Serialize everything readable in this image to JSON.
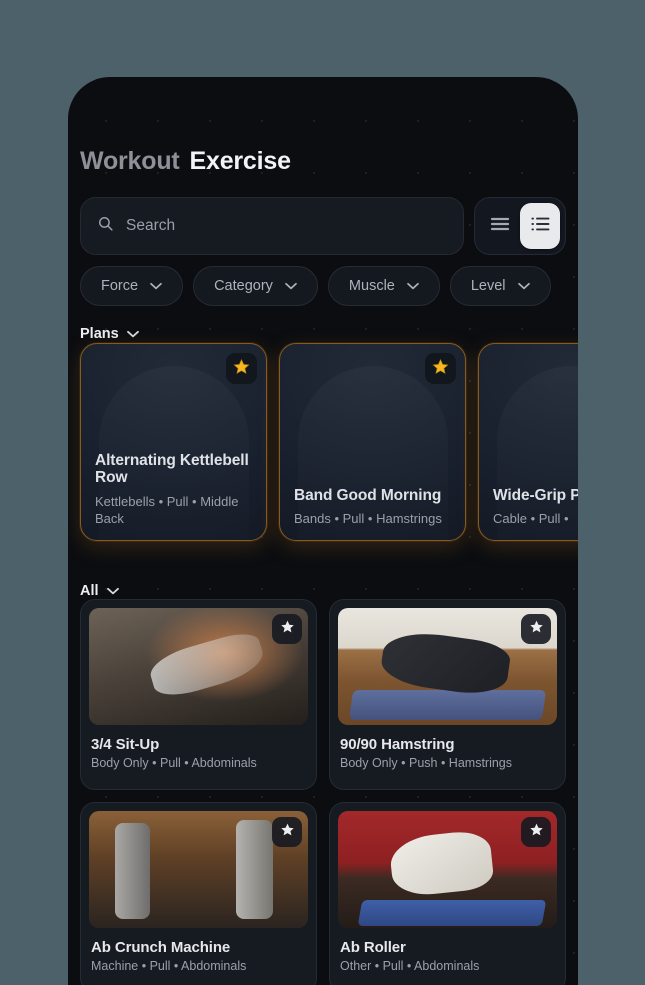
{
  "app": {
    "title_muted": "Workout",
    "title_strong": "Exercise"
  },
  "search": {
    "placeholder": "Search",
    "value": "",
    "icon": "search-icon"
  },
  "view_toggle": {
    "options": [
      {
        "name": "list-view",
        "icon": "hamburger-icon",
        "active": false
      },
      {
        "name": "detail-view",
        "icon": "list-detail-icon",
        "active": true
      }
    ]
  },
  "filters": [
    {
      "label": "Force",
      "icon": "chevron-down-icon"
    },
    {
      "label": "Category",
      "icon": "chevron-down-icon"
    },
    {
      "label": "Muscle",
      "icon": "chevron-down-icon"
    },
    {
      "label": "Level",
      "icon": "chevron-down-icon"
    }
  ],
  "sections": {
    "plans": {
      "label": "Plans",
      "icon": "chevron-down-icon"
    },
    "all": {
      "label": "All",
      "icon": "chevron-down-icon"
    }
  },
  "plans": [
    {
      "title": "Alternating Kettlebell Row",
      "meta": "Kettlebells • Pull • Middle Back",
      "starred": true,
      "star_icon": "star-filled-gold-icon"
    },
    {
      "title": "Band Good Morning",
      "meta": "Bands • Pull • Hamstrings",
      "starred": true,
      "star_icon": "star-filled-gold-icon"
    },
    {
      "title": "Wide-Grip Pulldown",
      "meta": "Cable • Pull •",
      "starred": true,
      "star_icon": "star-filled-gold-icon"
    }
  ],
  "exercises": [
    {
      "title": "3/4 Sit-Up",
      "meta": "Body Only • Pull • Abdominals",
      "star_icon": "star-icon",
      "thumb": "gym-floor-situp"
    },
    {
      "title": "90/90 Hamstring",
      "meta": "Body Only • Push • Hamstrings",
      "star_icon": "star-icon",
      "thumb": "room-floor-stretch"
    },
    {
      "title": "Ab Crunch Machine",
      "meta": "Machine • Pull • Abdominals",
      "star_icon": "star-icon",
      "thumb": "gym-machine"
    },
    {
      "title": "Ab Roller",
      "meta": "Other • Pull • Abdominals",
      "star_icon": "star-icon",
      "thumb": "red-rack-roller"
    }
  ],
  "colors": {
    "page_background": "#4c6169",
    "screen_background": "#0b0d11",
    "card_background": "#161a21",
    "plan_border": "#8a5a1c",
    "star_gold": "#f5b820",
    "text_primary": "#e6e8eb",
    "text_muted": "#9ba1aa",
    "accent_active": "#e9eaec"
  }
}
